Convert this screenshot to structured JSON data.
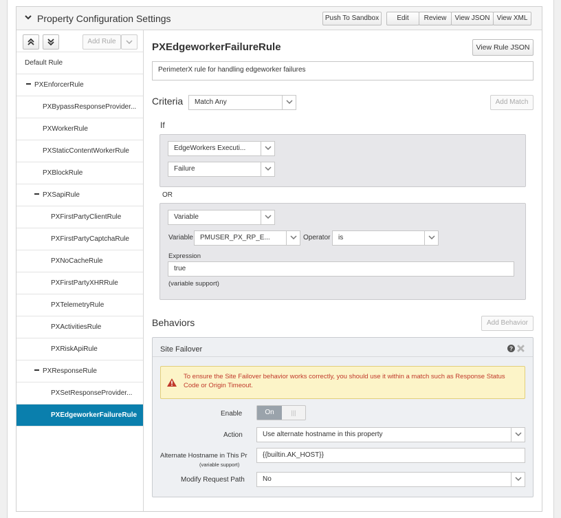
{
  "header": {
    "title": "Property Configuration Settings",
    "buttons": {
      "push_to_sandbox": "Push To Sandbox",
      "edit": "Edit",
      "review": "Review",
      "view_json": "View JSON",
      "view_xml": "View XML"
    }
  },
  "sidebar": {
    "add_rule": "Add Rule",
    "items": [
      {
        "label": "Default Rule",
        "level": 0,
        "collapsible": false,
        "active": false
      },
      {
        "label": "PXEnforcerRule",
        "level": 0,
        "collapsible": true,
        "active": false
      },
      {
        "label": "PXBypassResponseProvider...",
        "level": 1,
        "collapsible": false,
        "active": false
      },
      {
        "label": "PXWorkerRule",
        "level": 1,
        "collapsible": false,
        "active": false
      },
      {
        "label": "PXStaticContentWorkerRule",
        "level": 1,
        "collapsible": false,
        "active": false
      },
      {
        "label": "PXBlockRule",
        "level": 1,
        "collapsible": false,
        "active": false
      },
      {
        "label": "PXSapiRule",
        "level": 1,
        "collapsible": true,
        "active": false
      },
      {
        "label": "PXFirstPartyClientRule",
        "level": 2,
        "collapsible": false,
        "active": false
      },
      {
        "label": "PXFirstPartyCaptchaRule",
        "level": 2,
        "collapsible": false,
        "active": false
      },
      {
        "label": "PXNoCacheRule",
        "level": 2,
        "collapsible": false,
        "active": false
      },
      {
        "label": "PXFirstPartyXHRRule",
        "level": 2,
        "collapsible": false,
        "active": false
      },
      {
        "label": "PXTelemetryRule",
        "level": 2,
        "collapsible": false,
        "active": false
      },
      {
        "label": "PXActivitiesRule",
        "level": 2,
        "collapsible": false,
        "active": false
      },
      {
        "label": "PXRiskApiRule",
        "level": 2,
        "collapsible": false,
        "active": false
      },
      {
        "label": "PXResponseRule",
        "level": 1,
        "collapsible": true,
        "active": false
      },
      {
        "label": "PXSetResponseProvider...",
        "level": 2,
        "collapsible": false,
        "active": false
      },
      {
        "label": "PXEdgeworkerFailureRule",
        "level": 2,
        "collapsible": false,
        "active": true
      }
    ]
  },
  "rule": {
    "name": "PXEdgeworkerFailureRule",
    "view_rule_json": "View Rule JSON",
    "comment": "PerimeterX rule for handling edgeworker failures"
  },
  "criteria": {
    "label": "Criteria",
    "match_mode": "Match Any",
    "add_match": "Add Match",
    "if_label": "If",
    "or_label": "OR",
    "condition1": {
      "type": "EdgeWorkers Executi...",
      "value": "Failure"
    },
    "condition2": {
      "type": "Variable",
      "variable_label": "Variable",
      "variable": "PMUSER_PX_RP_E...",
      "operator_label": "Operator",
      "operator": "is",
      "expression_label": "Expression",
      "expression": "true",
      "variable_support": "(variable support)"
    }
  },
  "behaviors": {
    "label": "Behaviors",
    "add_behavior": "Add Behavior",
    "site_failover": {
      "title": "Site Failover",
      "warning": "To ensure the Site Failover behavior works correctly, you should use it within a match such as Response Status Code or Origin Timeout.",
      "enable_label": "Enable",
      "enable_on": "On",
      "enable_off": "|||",
      "action_label": "Action",
      "action_value": "Use alternate hostname in this property",
      "alt_hostname_label": "Alternate Hostname in This Pr",
      "alt_hostname_sub": "(variable support)",
      "alt_hostname_value": "{{builtin.AK_HOST}}",
      "modify_path_label": "Modify Request Path",
      "modify_path_value": "No"
    }
  },
  "colors": {
    "accent": "#0a7fad",
    "warning_bg": "#fcf4c8",
    "warning_text": "#c0392b"
  }
}
